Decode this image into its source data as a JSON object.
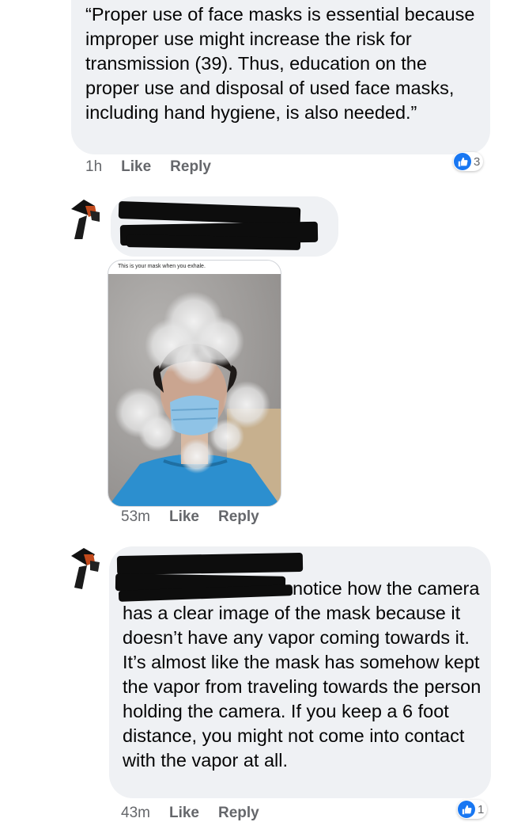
{
  "comments": [
    {
      "text": "“Proper use of face masks is essential because improper use might increase the risk for transmission (39). Thus, education on the proper use and disposal of used face masks, including hand hygiene, is also needed.”",
      "time": "1h",
      "like_label": "Like",
      "reply_label": "Reply",
      "reaction_count": "3",
      "reaction_icon": "thumbs-up-icon"
    },
    {
      "author": "",
      "image_caption": "This is your mask when you exhale.",
      "time": "53m",
      "like_label": "Like",
      "reply_label": "Reply"
    },
    {
      "author": "",
      "text": "notice how the camera has a clear image of the mask because it doesn’t have any vapor coming towards it. It’s almost like the mask has somehow kept the vapor from traveling towards the person holding the camera. If you keep a 6 foot distance, you might not come into contact with the vapor at all.",
      "time": "43m",
      "like_label": "Like",
      "reply_label": "Reply",
      "reaction_count": "1",
      "reaction_icon": "thumbs-up-icon"
    }
  ],
  "colors": {
    "bubble": "#eff1f4",
    "meta_text": "#65676b",
    "like_blue": "#1877f2",
    "redaction": "#0d0d0d"
  }
}
